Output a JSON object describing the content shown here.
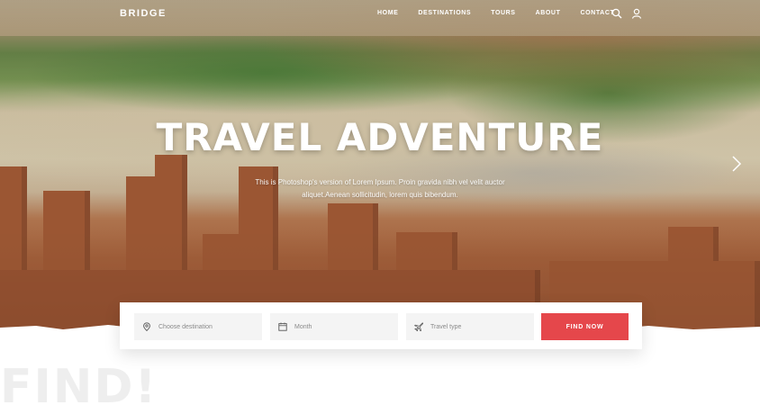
{
  "brand": {
    "logo": "BRIDGE"
  },
  "nav": {
    "items": [
      {
        "label": "HOME"
      },
      {
        "label": "DESTINATIONS"
      },
      {
        "label": "TOURS"
      },
      {
        "label": "ABOUT"
      },
      {
        "label": "CONTACT"
      }
    ],
    "icons": [
      "search-icon",
      "user-icon"
    ]
  },
  "hero": {
    "title": "TRAVEL ADVENTURE",
    "subtitle": "This is Photoshop's version  of Lorem Ipsum. Proin gravida nibh vel velit auctor aliquet.Aenean sollicitudin, lorem quis bibendum."
  },
  "search": {
    "destination_placeholder": "Choose destination",
    "month_placeholder": "Month",
    "type_placeholder": "Travel type",
    "button_label": "FIND NOW"
  },
  "section": {
    "background_word": "FIND!"
  },
  "colors": {
    "accent": "#e5474b",
    "field_bg": "#f4f4f4"
  }
}
